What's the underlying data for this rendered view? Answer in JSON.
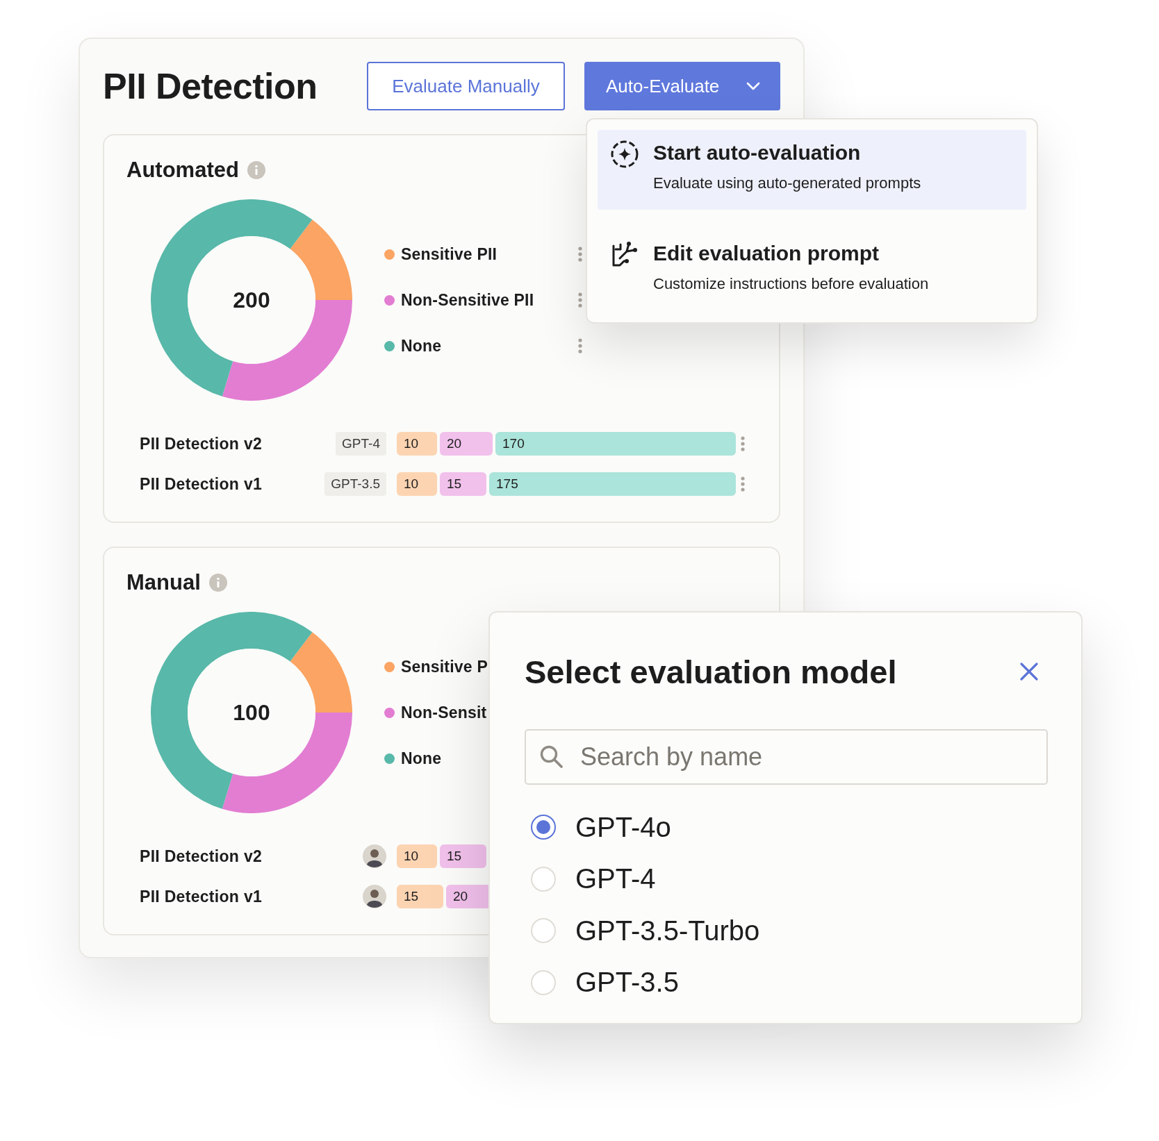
{
  "title": "PII Detection",
  "buttons": [
    {
      "label": "Evaluate Manually",
      "kind": "outline"
    },
    {
      "label": "Auto-Evaluate",
      "kind": "dropdown"
    }
  ],
  "sections": [
    {
      "title": "Automated",
      "total": "200",
      "legend": [
        {
          "label": "Sensitive PII",
          "color": "#fba463",
          "menu": true
        },
        {
          "label": "Non-Sensitive PII",
          "color": "#e27dd2",
          "menu": true
        },
        {
          "label": "None",
          "color": "#58b8a9",
          "menu": true
        }
      ],
      "rows": [
        {
          "name": "PII Detection v2",
          "kind": "model",
          "model": "GPT-4",
          "menu": true,
          "segments": [
            {
              "value": "10",
              "color": "#fdd4b2"
            },
            {
              "value": "20",
              "color": "#f1c0eb"
            },
            {
              "value": "170",
              "color": "#abe4da"
            }
          ]
        },
        {
          "name": "PII Detection v1",
          "kind": "model",
          "model": "GPT-3.5",
          "menu": true,
          "segments": [
            {
              "value": "10",
              "color": "#fdd4b2"
            },
            {
              "value": "15",
              "color": "#f1c0eb"
            },
            {
              "value": "175",
              "color": "#abe4da"
            }
          ]
        }
      ]
    },
    {
      "title": "Manual",
      "total": "100",
      "legend": [
        {
          "label": "Sensitive P",
          "color": "#fba463"
        },
        {
          "label": "Non-Sensit",
          "color": "#e27dd2"
        },
        {
          "label": "None",
          "color": "#58b8a9"
        }
      ],
      "rows": [
        {
          "name": "PII Detection v2",
          "kind": "user",
          "segments": [
            {
              "value": "10",
              "color": "#fdd4b2"
            },
            {
              "value": "15",
              "color": "#f1c0eb"
            }
          ]
        },
        {
          "name": "PII Detection v1",
          "kind": "user",
          "segments": [
            {
              "value": "15",
              "color": "#fdd4b2"
            },
            {
              "value": "20",
              "color": "#f1c0eb"
            }
          ]
        }
      ]
    }
  ],
  "menu": {
    "items": [
      {
        "kind": "sparkle",
        "title": "Start auto-evaluation",
        "subtitle": "Evaluate using auto-generated prompts",
        "selected": true
      },
      {
        "kind": "branch",
        "title": "Edit evaluation prompt",
        "subtitle": "Customize instructions before evaluation",
        "selected": false
      }
    ]
  },
  "dialog": {
    "title": "Select evaluation model",
    "search": {
      "placeholder": "Search by name"
    },
    "options": [
      {
        "label": "GPT-4o",
        "selected": true
      },
      {
        "label": "GPT-4",
        "selected": false
      },
      {
        "label": "GPT-3.5-Turbo",
        "selected": false
      },
      {
        "label": "GPT-3.5",
        "selected": false
      }
    ]
  }
}
